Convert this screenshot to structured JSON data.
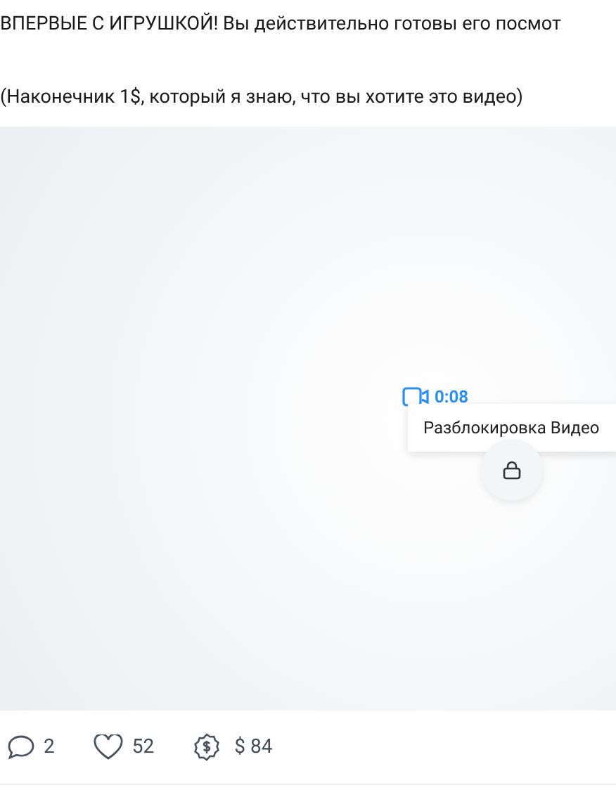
{
  "post": {
    "title": "ВПЕРВЫЕ С ИГРУШКОЙ! Вы действительно готовы его посмот",
    "note": "(Наконечник 1$, который я знаю, что вы хотите это видео)"
  },
  "media": {
    "duration": "0:08",
    "unlock_label": "Разблокировка Видео",
    "locked": true
  },
  "stats": {
    "comments": "2",
    "likes": "52",
    "tips": "$ 84"
  }
}
